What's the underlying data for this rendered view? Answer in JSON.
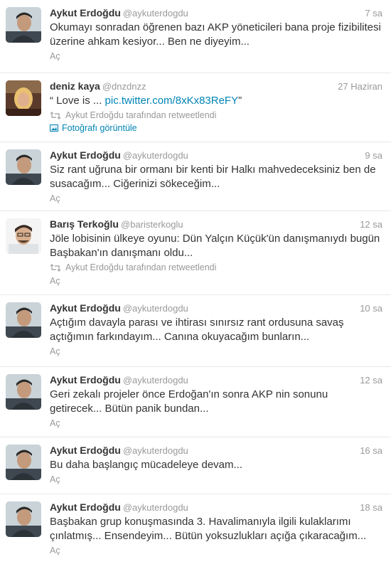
{
  "tweets": [
    {
      "name": "Aykut Erdoğdu",
      "handle": "@aykuterdogdu",
      "time": "7 sa",
      "lines": [
        "Okumayı sonradan öğrenen bazı AKP yöneticileri bana proje fizibilitesi",
        "üzerine ahkam kesiyor... Ben ne diyeyim..."
      ],
      "open": "Aç",
      "avatar": "aykut"
    },
    {
      "name": "deniz kaya",
      "handle": "@dnzdnzz",
      "time": "27 Haziran",
      "prefix": "“ Love is ... ",
      "link": "pic.twitter.com/8xKx83ReFY",
      "suffix": "”",
      "retweet": "Aykut Erdoğdu tarafından retweetlendi",
      "photo": "Fotoğrafı görüntüle",
      "avatar": "deniz"
    },
    {
      "name": "Aykut Erdoğdu",
      "handle": "@aykuterdogdu",
      "time": "9 sa",
      "lines": [
        "Siz rant uğruna bir ormanı bir kenti bir Halkı mahvedeceksiniz ben de",
        "susacağım... Ciğerinizi sökeceğim..."
      ],
      "open": "Aç",
      "avatar": "aykut"
    },
    {
      "name": "Barış Terkoğlu",
      "handle": "@baristerkoglu",
      "time": "12 sa",
      "lines": [
        "Jöle lobisinin ülkeye oyunu: Dün Yalçın Küçük'ün danışmanıydı bugün",
        "Başbakan'ın danışmanı oldu..."
      ],
      "retweet": "Aykut Erdoğdu tarafından retweetlendi",
      "open": "Aç",
      "avatar": "baris"
    },
    {
      "name": "Aykut Erdoğdu",
      "handle": "@aykuterdogdu",
      "time": "10 sa",
      "lines": [
        "Açtığım davayla parası ve ihtirası sınırsız rant ordusuna savaş",
        "açtığımın farkındayım... Canına okuyacağım bunların..."
      ],
      "open": "Aç",
      "avatar": "aykut"
    },
    {
      "name": "Aykut Erdoğdu",
      "handle": "@aykuterdogdu",
      "time": "12 sa",
      "lines": [
        "Geri zekalı projeler önce Erdoğan'ın sonra AKP nin sonunu",
        "getirecek... Bütün panik bundan..."
      ],
      "open": "Aç",
      "avatar": "aykut"
    },
    {
      "name": "Aykut Erdoğdu",
      "handle": "@aykuterdogdu",
      "time": "16 sa",
      "lines": [
        "Bu daha başlangıç mücadeleye devam..."
      ],
      "open": "Aç",
      "avatar": "aykut"
    },
    {
      "name": "Aykut Erdoğdu",
      "handle": "@aykuterdogdu",
      "time": "18 sa",
      "lines": [
        "Başbakan grup konuşmasında 3. Havalimanıyla ilgili kulaklarımı",
        "çınlatmış... Ensendeyim... Bütün yoksuzlukları açığa çıkaracağım..."
      ],
      "open": "Aç",
      "avatar": "aykut"
    }
  ],
  "colors": {
    "link": "#0084b4",
    "muted": "#999999",
    "text": "#333333",
    "divider": "#e8e8e8"
  }
}
